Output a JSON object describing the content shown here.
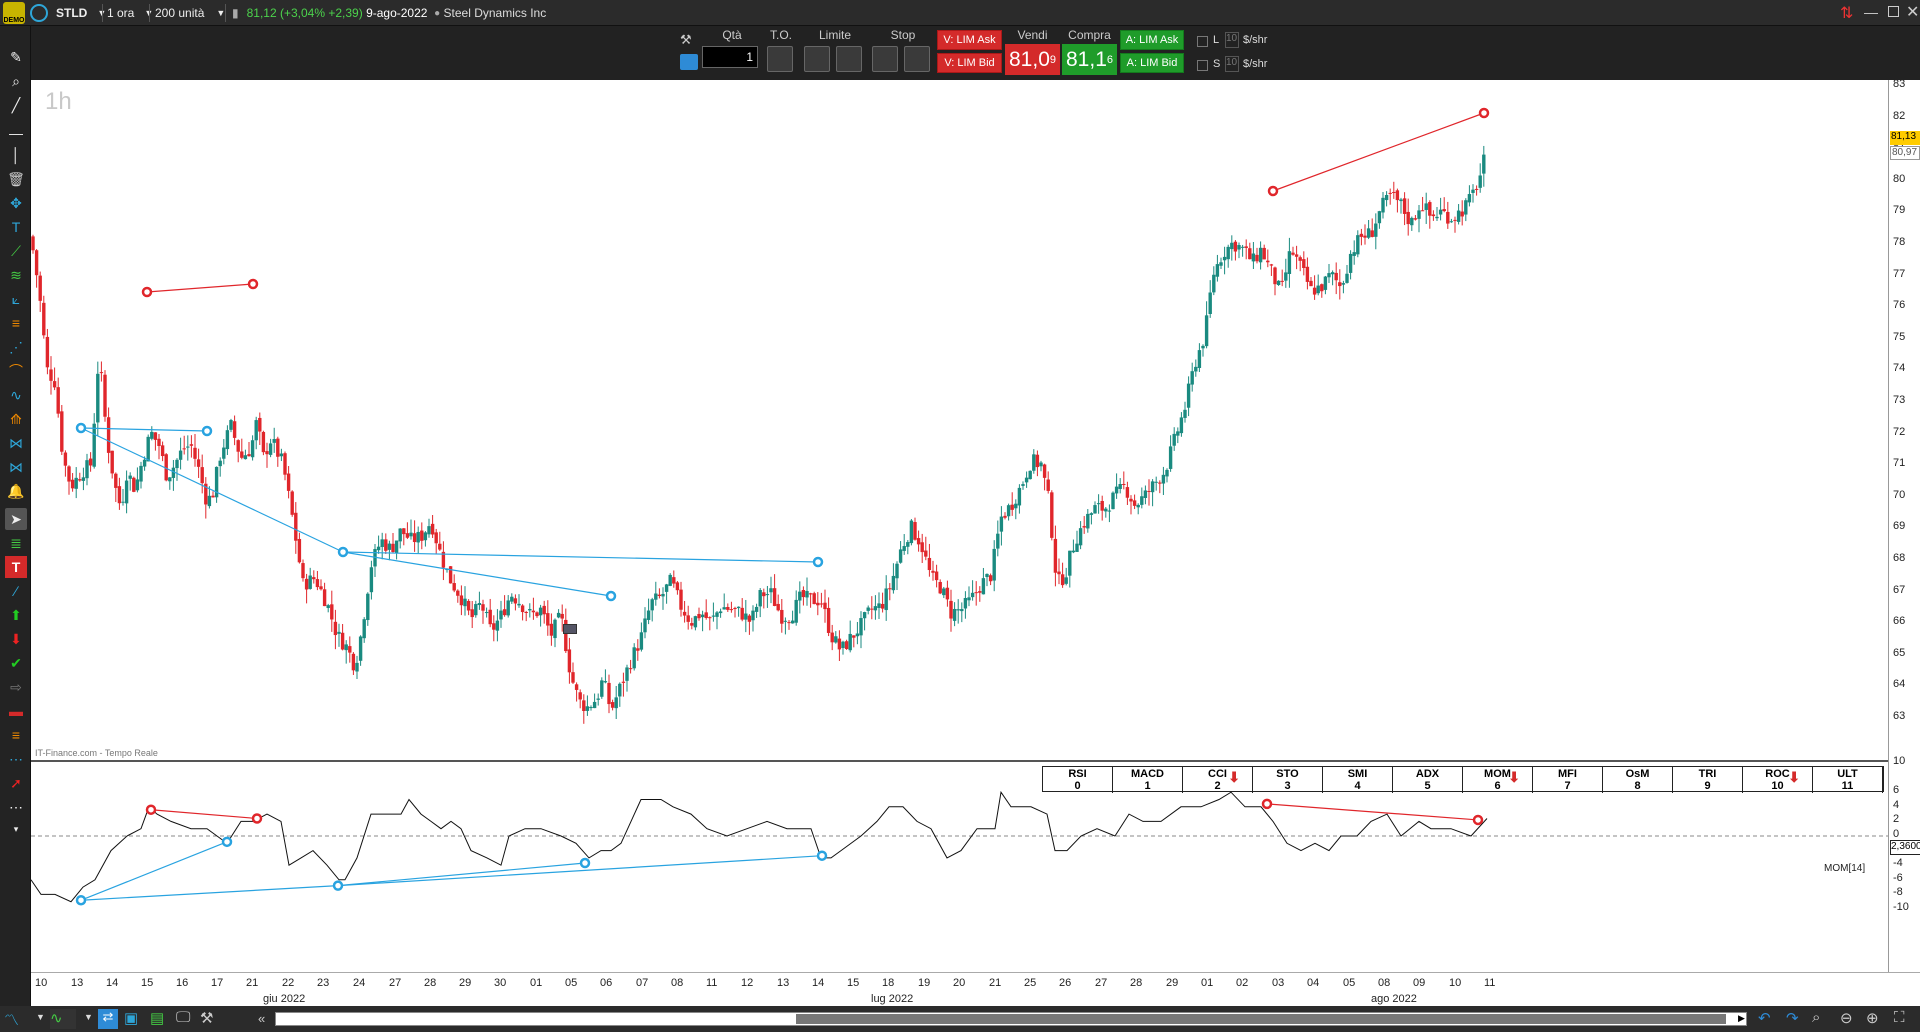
{
  "toolbar": {
    "logo_text": "DEMO",
    "symbol": "STLD",
    "timeframe": "1 ora",
    "units": "200 unità",
    "last_price": "81,12",
    "change": "(+3,04% +2,39)",
    "date": "9-ago-2022",
    "company": "Steel Dynamics Inc"
  },
  "trade": {
    "qty_label": "Qtà",
    "qty_value": "1",
    "to_label": "T.O.",
    "limit_label": "Limite",
    "stop_label": "Stop",
    "sell_ask": "V: LIM Ask",
    "sell_bid": "V: LIM Bid",
    "vendi_label": "Vendi",
    "compra_label": "Compra",
    "vendi_price": "81,0",
    "vendi_sup": "9",
    "compra_price": "81,1",
    "compra_sup": "6",
    "buy_ask": "A: LIM Ask",
    "buy_bid": "A: LIM Bid",
    "l_label": "L",
    "s_label": "S",
    "l_val": "10",
    "s_val": "10",
    "unit1": "$/shr",
    "unit2": "$/shr"
  },
  "chart": {
    "timeframe_label": "1h",
    "source": "IT-Finance.com - Tempo Reale",
    "price_tag": "81,13",
    "price_tag2": "80,97",
    "mom_tag": "2,3600",
    "mom_label": "MOM[14]"
  },
  "price_axis": [
    "83",
    "82",
    "81",
    "80",
    "79",
    "78",
    "77",
    "76",
    "75",
    "74",
    "73",
    "72",
    "71",
    "70",
    "69",
    "68",
    "67",
    "66",
    "65",
    "64",
    "63"
  ],
  "mom_axis": [
    "10",
    "6",
    "4",
    "2",
    "0",
    "-2",
    "-4",
    "-6",
    "-8",
    "-10"
  ],
  "indicators": [
    {
      "n": "RSI",
      "v": "0",
      "arrow": false
    },
    {
      "n": "MACD",
      "v": "1",
      "arrow": false
    },
    {
      "n": "CCI",
      "v": "2",
      "arrow": true
    },
    {
      "n": "STO",
      "v": "3",
      "arrow": false
    },
    {
      "n": "SMI",
      "v": "4",
      "arrow": false
    },
    {
      "n": "ADX",
      "v": "5",
      "arrow": false
    },
    {
      "n": "MOM",
      "v": "6",
      "arrow": true
    },
    {
      "n": "MFI",
      "v": "7",
      "arrow": false
    },
    {
      "n": "OsM",
      "v": "8",
      "arrow": false
    },
    {
      "n": "TRI",
      "v": "9",
      "arrow": false
    },
    {
      "n": "ROC",
      "v": "10",
      "arrow": true
    },
    {
      "n": "ULT",
      "v": "11",
      "arrow": false
    }
  ],
  "x_days": [
    "10",
    "13",
    "14",
    "15",
    "16",
    "17",
    "21",
    "22",
    "23",
    "24",
    "27",
    "28",
    "29",
    "30",
    "01",
    "05",
    "06",
    "07",
    "08",
    "11",
    "12",
    "13",
    "14",
    "15",
    "18",
    "19",
    "20",
    "21",
    "25",
    "26",
    "27",
    "28",
    "29",
    "01",
    "02",
    "03",
    "04",
    "05",
    "08",
    "09",
    "10",
    "11"
  ],
  "x_months": [
    "giu 2022",
    "lug 2022",
    "ago 2022"
  ],
  "colors": {
    "up": "#1a8a80",
    "down": "#e0262b",
    "blue": "#29a3e0",
    "red": "#e0262b"
  }
}
